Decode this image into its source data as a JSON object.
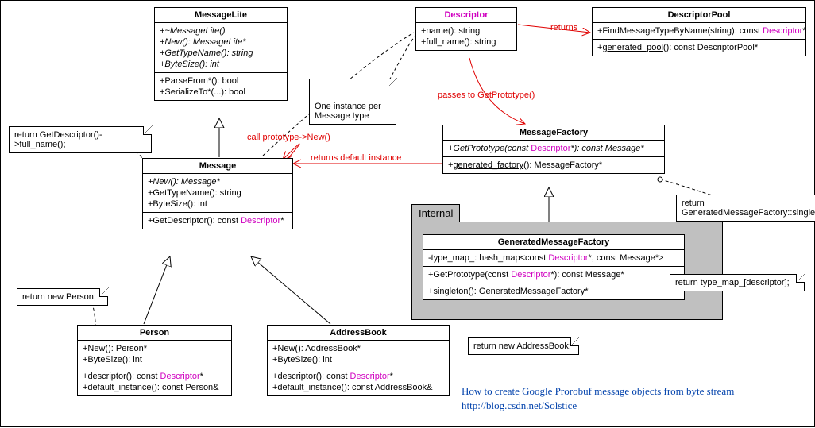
{
  "classes": {
    "MessageLite": {
      "name": "MessageLite",
      "methods1": [
        {
          "text": "+~MessageLite()",
          "italic": true
        },
        {
          "text": "+New(): MessageLite*",
          "italic": true
        },
        {
          "text": "+GetTypeName(): string",
          "italic": true
        },
        {
          "text": "+ByteSize(): int",
          "italic": true
        }
      ],
      "methods2": [
        {
          "text": "+ParseFrom*(): bool"
        },
        {
          "text": "+SerializeTo*(...): bool"
        }
      ]
    },
    "Message": {
      "name": "Message",
      "methods1": [
        {
          "text": "+New(): Message*",
          "italic": true
        },
        {
          "text": "+GetTypeName(): string"
        },
        {
          "text": "+ByteSize(): int"
        }
      ],
      "methods2": [
        {
          "pre": "+GetDescriptor(): const ",
          "mag": "Descriptor",
          "post": "*"
        }
      ]
    },
    "Person": {
      "name": "Person",
      "methods1": [
        {
          "text": "+New(): Person*"
        },
        {
          "text": "+ByteSize(): int"
        }
      ],
      "methods2": [
        {
          "pre": "+",
          "und_pre": "descriptor",
          "mid": "(): const ",
          "mag": "Descriptor",
          "post": "*"
        },
        {
          "und": "+default_instance(): const Person&"
        }
      ]
    },
    "AddressBook": {
      "name": "AddressBook",
      "methods1": [
        {
          "text": "+New(): AddressBook*"
        },
        {
          "text": "+ByteSize(): int"
        }
      ],
      "methods2": [
        {
          "pre": "+",
          "und_pre": "descriptor",
          "mid": "(): const ",
          "mag": "Descriptor",
          "post": "*"
        },
        {
          "und": "+default_instance(): const AddressBook&"
        }
      ]
    },
    "Descriptor": {
      "name": "Descriptor",
      "methods1": [
        {
          "text": "+name(): string"
        },
        {
          "text": "+full_name(): string"
        }
      ]
    },
    "DescriptorPool": {
      "name": "DescriptorPool",
      "methods1": [
        {
          "pre": "+FindMessageTypeByName(string): const ",
          "mag": "Descriptor",
          "post": "*"
        }
      ],
      "methods2": [
        {
          "pre": "+",
          "und_pre": "generated_pool",
          "mid": "(): const DescriptorPool*"
        }
      ]
    },
    "MessageFactory": {
      "name": "MessageFactory",
      "methods1": [
        {
          "pre": "+GetPrototype(const ",
          "italic": true,
          "mag": "Descriptor",
          "post": "*): const Message*"
        }
      ],
      "methods2": [
        {
          "pre": "+",
          "und_pre": "generated_factory",
          "mid": "(): MessageFactory*"
        }
      ]
    },
    "GeneratedMessageFactory": {
      "name": "GeneratedMessageFactory",
      "attrs": [
        {
          "pre": "-type_map_: hash_map<const ",
          "mag": "Descriptor",
          "post": "*, const Message*>"
        }
      ],
      "methods1": [
        {
          "pre": "+GetPrototype(const ",
          "mag": "Descriptor",
          "post": "*): const Message*"
        }
      ],
      "methods2": [
        {
          "pre": "+",
          "und_pre": "singleton",
          "mid": "(): GeneratedMessageFactory*"
        }
      ]
    }
  },
  "notes": {
    "getdesc": "return GetDescriptor()->full_name();",
    "newperson": "return new Person;",
    "newab": "return new AddressBook;",
    "oneinst": "One instance per\nMessage type",
    "singleton": "return GeneratedMessageFactory::singleton();",
    "typemap": "return type_map_[descriptor];"
  },
  "annotations": {
    "callnew": "call prototype->New()",
    "returnsdef": "returns default instance",
    "passes": "passes to GetPrototype()",
    "returns": "returns"
  },
  "frame": {
    "internal": "Internal"
  },
  "footer": {
    "line1": "How to create Google Prorobuf message objects from byte stream",
    "line2": "http://blog.csdn.net/Solstice"
  }
}
